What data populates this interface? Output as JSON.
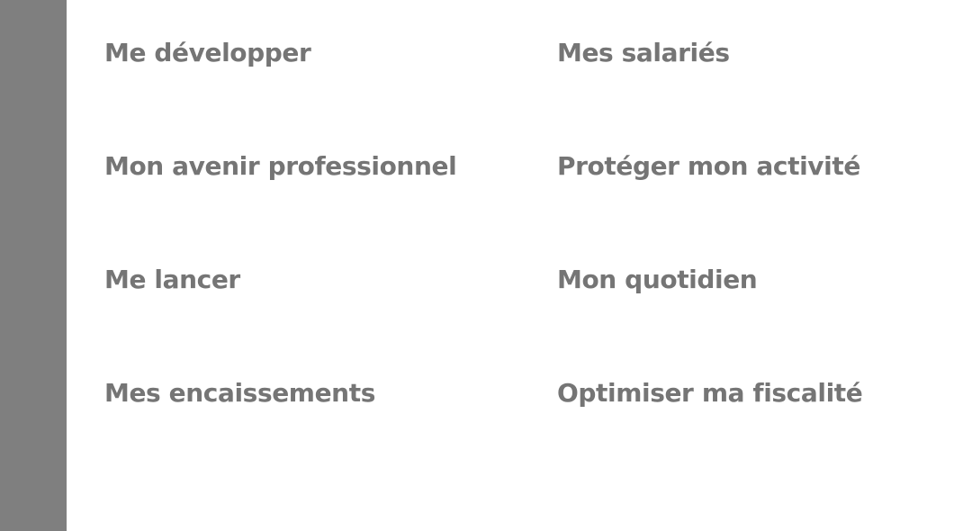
{
  "colors": {
    "sidebar": "#7f7f7f",
    "link_text": "#757575",
    "background": "#ffffff"
  },
  "menu": {
    "items": [
      {
        "label": "Me développer"
      },
      {
        "label": "Mes salariés"
      },
      {
        "label": "Mon avenir professionnel"
      },
      {
        "label": "Protéger mon activité"
      },
      {
        "label": "Me lancer"
      },
      {
        "label": "Mon quotidien"
      },
      {
        "label": "Mes encaissements"
      },
      {
        "label": "Optimiser ma fiscalité"
      }
    ]
  }
}
